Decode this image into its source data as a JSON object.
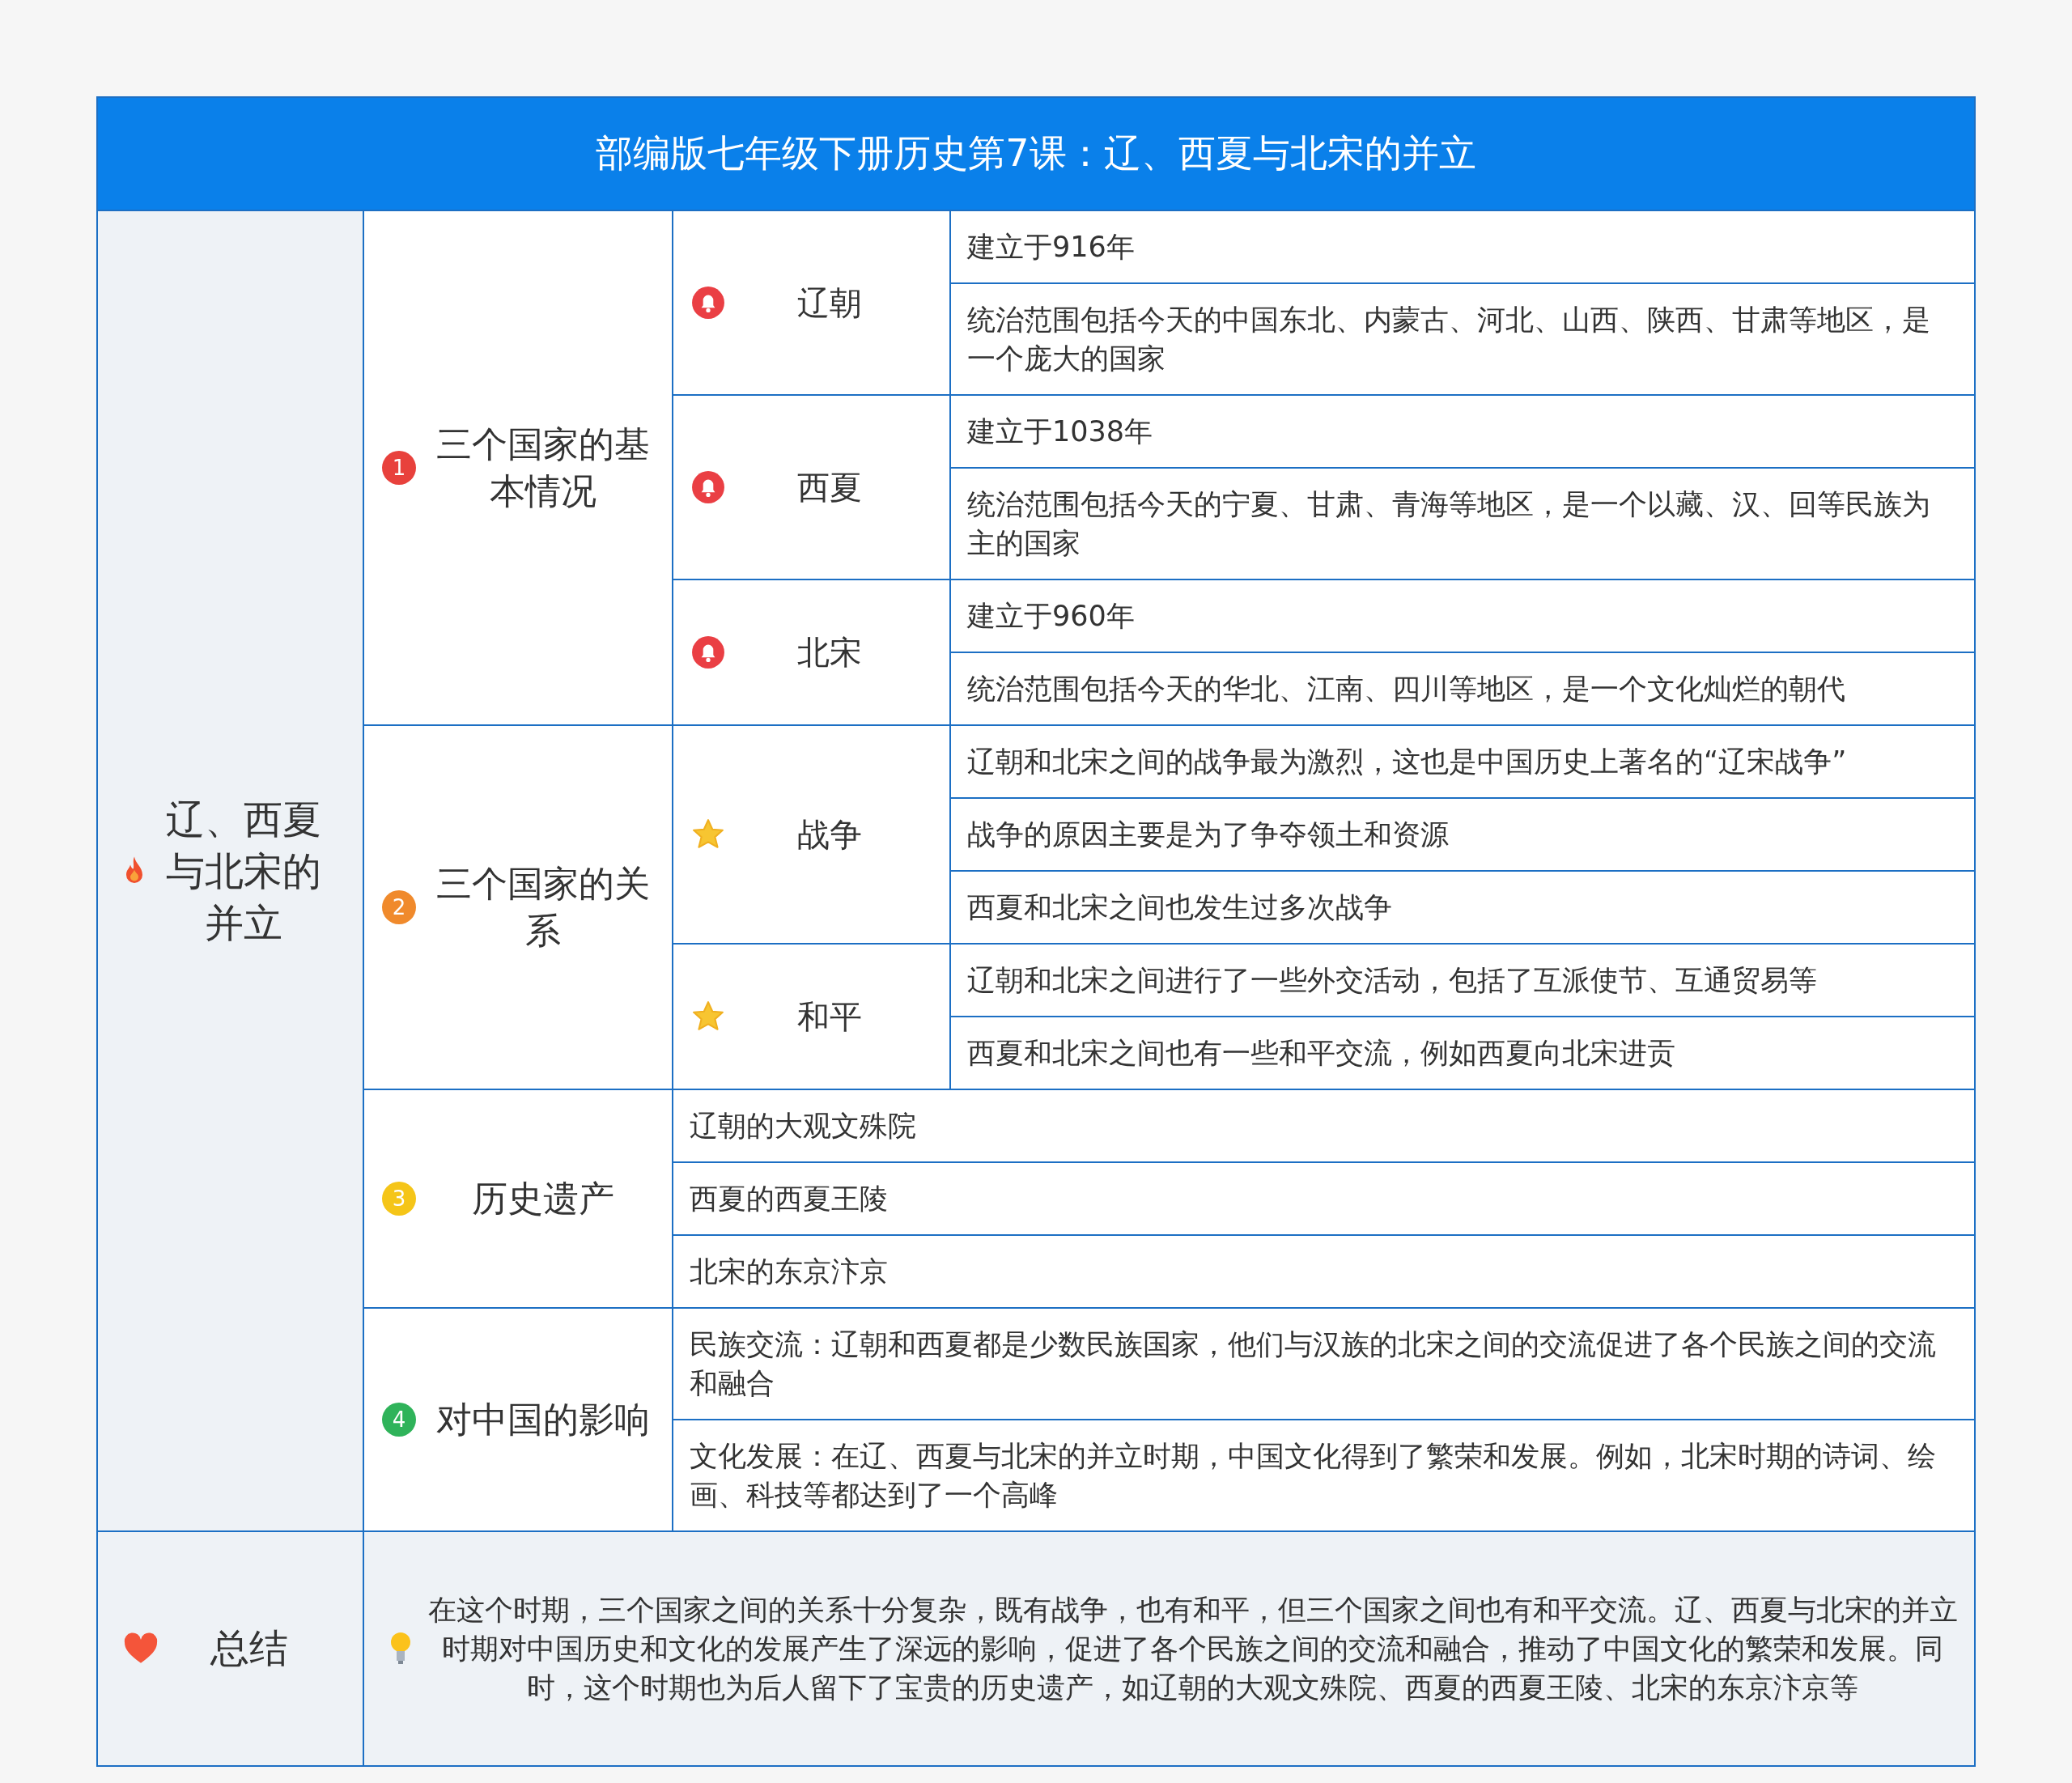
{
  "title": "部编版七年级下册历史第7课：辽、西夏与北宋的并立",
  "root": {
    "label": "辽、西夏与北宋的并立",
    "sections": [
      {
        "number": "1",
        "color": "#e8413c",
        "label": "三个国家的基本情况",
        "kind": "groups",
        "groups": [
          {
            "kind": "bell",
            "label": "辽朝",
            "items": [
              "建立于916年",
              "统治范围包括今天的中国东北、内蒙古、河北、山西、陕西、甘肃等地区，是一个庞大的国家"
            ]
          },
          {
            "kind": "bell",
            "label": "西夏",
            "items": [
              "建立于1038年",
              "统治范围包括今天的宁夏、甘肃、青海等地区，是一个以藏、汉、回等民族为主的国家"
            ]
          },
          {
            "kind": "bell",
            "label": "北宋",
            "items": [
              "建立于960年",
              "统治范围包括今天的华北、江南、四川等地区，是一个文化灿烂的朝代"
            ]
          }
        ]
      },
      {
        "number": "2",
        "color": "#f08a2c",
        "label": "三个国家的关系",
        "kind": "groups",
        "groups": [
          {
            "kind": "star",
            "label": "战争",
            "items": [
              "辽朝和北宋之间的战争最为激烈，这也是中国历史上著名的“辽宋战争”",
              "战争的原因主要是为了争夺领土和资源",
              "西夏和北宋之间也发生过多次战争"
            ]
          },
          {
            "kind": "star",
            "label": "和平",
            "items": [
              "辽朝和北宋之间进行了一些外交活动，包括了互派使节、互通贸易等",
              "西夏和北宋之间也有一些和平交流，例如西夏向北宋进贡"
            ]
          }
        ]
      },
      {
        "number": "3",
        "color": "#f5c518",
        "label": "历史遗产",
        "kind": "items",
        "items": [
          "辽朝的大观文殊院",
          "西夏的西夏王陵",
          "北宋的东京汴京"
        ]
      },
      {
        "number": "4",
        "color": "#2fb35a",
        "label": "对中国的影响",
        "kind": "items",
        "items": [
          "民族交流：辽朝和西夏都是少数民族国家，他们与汉族的北宋之间的交流促进了各个民族之间的交流和融合",
          "文化发展：在辽、西夏与北宋的并立时期，中国文化得到了繁荣和发展。例如，北宋时期的诗词、绘画、科技等都达到了一个高峰"
        ]
      }
    ]
  },
  "summary": {
    "label": "总结",
    "text": "在这个时期，三个国家之间的关系十分复杂，既有战争，也有和平，但三个国家之间也有和平交流。辽、西夏与北宋的并立时期对中国历史和文化的发展产生了深远的影响，促进了各个民族之间的交流和融合，推动了中国文化的繁荣和发展。同时，这个时期也为后人留下了宝贵的历史遗产，如辽朝的大观文殊院、西夏的西夏王陵、北宋的东京汴京等"
  }
}
